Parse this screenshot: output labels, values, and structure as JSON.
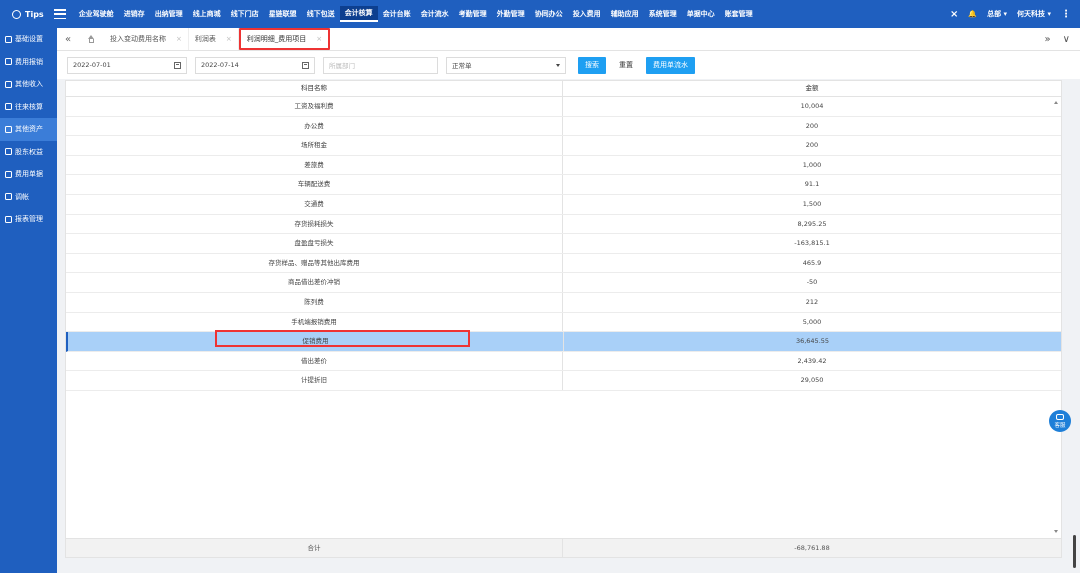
{
  "topnav": {
    "logo": "Tips",
    "items": [
      "企业驾驶舱",
      "进销存",
      "出纳管理",
      "线上商城",
      "线下门店",
      "星链联盟",
      "线下包送",
      "会计核算",
      "会计台账",
      "会计流水",
      "考勤管理",
      "外勤管理",
      "协同办公",
      "投入费用",
      "辅助应用",
      "系统管理",
      "单据中心",
      "账套管理"
    ],
    "active_index": 7,
    "close_label": "×",
    "bell_label": "🔔",
    "user_label": "总部 ▾",
    "company_label": "何天科技 ▾",
    "more_label": "⋮"
  },
  "sidebar": {
    "items": [
      "基础设置",
      "费用报销",
      "其他收入",
      "往来核算",
      "其他资产",
      "股东权益",
      "费用单据",
      "调帐",
      "报表管理"
    ],
    "active_index": 4
  },
  "tabs": {
    "prev_label": "«",
    "items": [
      {
        "label": "投入变动费用名称",
        "close": "×"
      },
      {
        "label": "利润表",
        "close": "×"
      },
      {
        "label": "利润明细_费用项目",
        "close": "×"
      }
    ],
    "active_index": 2,
    "right_labels": [
      "»",
      "∨"
    ]
  },
  "filters": {
    "start_date": "2022-07-01",
    "end_date": "2022-07-14",
    "dept_placeholder": "所属部门",
    "status": "正常单",
    "search_label": "搜索",
    "reset_label": "重置",
    "flow_label": "费用单流水"
  },
  "table": {
    "headers": [
      "科目名称",
      "金额"
    ],
    "rows": [
      {
        "name": "工资及福利费",
        "amount": "10,004"
      },
      {
        "name": "办公费",
        "amount": "200"
      },
      {
        "name": "场所租金",
        "amount": "200"
      },
      {
        "name": "差旅费",
        "amount": "1,000"
      },
      {
        "name": "车辆配送费",
        "amount": "91.1"
      },
      {
        "name": "交通费",
        "amount": "1,500"
      },
      {
        "name": "存货损耗损失",
        "amount": "8,295.25"
      },
      {
        "name": "盘盈盘亏损失",
        "amount": "-163,815.1"
      },
      {
        "name": "存货样品、赠品等其他出库费用",
        "amount": "465.9"
      },
      {
        "name": "商品借出差价冲销",
        "amount": "-50"
      },
      {
        "name": "陈列费",
        "amount": "212"
      },
      {
        "name": "手机端报销费用",
        "amount": "5,000"
      },
      {
        "name": "促销费用",
        "amount": "36,645.55"
      },
      {
        "name": "借出差价",
        "amount": "2,439.42"
      },
      {
        "name": "计提折旧",
        "amount": "29,050"
      }
    ],
    "selected_index": 12,
    "footer_label": "合计",
    "footer_total": "-68,761.88"
  },
  "cs": {
    "label": "客服"
  },
  "colors": {
    "brand": "#1f5fbf",
    "accent": "#1e9ff2",
    "selected_row": "#a9d0f8",
    "highlight": "#e33333"
  }
}
